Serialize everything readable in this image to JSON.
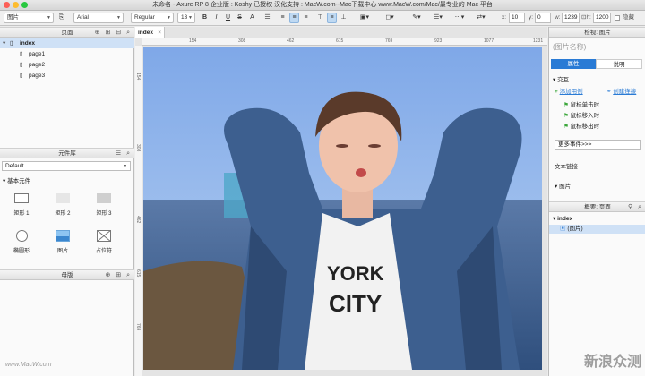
{
  "window": {
    "title": "未命名 - Axure RP 8 企业版 : Koshy 已授权 汉化支持 : MacW.com--Mac下载中心 www.MacW.com/Mac/最专业的 Mac 平台"
  },
  "toolbar": {
    "type_select": "图片",
    "font_select": "Arial",
    "weight_select": "Regular",
    "size_select": "13",
    "bold": "B",
    "italic": "I",
    "underline": "U",
    "strike": "S",
    "x_label": "x:",
    "x_value": "10",
    "y_label": "y:",
    "y_value": "0",
    "w_label": "w:",
    "w_value": "1239",
    "h_value": "1200",
    "hidden_label": "隐藏"
  },
  "pages_panel": {
    "header": "页面",
    "root": "index",
    "items": [
      "page1",
      "page2",
      "page3"
    ]
  },
  "library_panel": {
    "header": "元件库",
    "selected_library": "Default",
    "category": "基本元件",
    "widgets": [
      {
        "label": "矩形 1",
        "icon": "rectangle-icon"
      },
      {
        "label": "矩形 2",
        "icon": "rectangle-icon"
      },
      {
        "label": "矩形 3",
        "icon": "rectangle-icon"
      },
      {
        "label": "椭圆形",
        "icon": "ellipse-icon"
      },
      {
        "label": "图片",
        "icon": "image-icon"
      },
      {
        "label": "占位符",
        "icon": "placeholder-icon"
      }
    ]
  },
  "masters_panel": {
    "header": "母版"
  },
  "canvas": {
    "tab_label": "index",
    "ruler_h": [
      "154",
      "308",
      "462",
      "615",
      "769",
      "923",
      "1077",
      "1231"
    ],
    "ruler_v": [
      "154",
      "308",
      "462",
      "615",
      "769"
    ]
  },
  "inspector": {
    "header": "检视: 图片",
    "name_placeholder": "(图片名称)",
    "tabs": [
      "属性",
      "说明"
    ],
    "interaction_title": "交互",
    "add_case": "添加用例",
    "create_link": "创建连接",
    "events": [
      "鼠标单击时",
      "鼠标移入时",
      "鼠标移出时"
    ],
    "more_events": "更多事件>>>",
    "text_link": "文本链接",
    "image_section": "图片"
  },
  "outline_panel": {
    "header": "概要: 页面",
    "root": "index",
    "item": "(图片)"
  },
  "colors": {
    "accent": "#2a7bd5",
    "selected_row": "#cfe1f6"
  },
  "watermark": {
    "left": "www.MacW.com",
    "right": "新浪众测"
  }
}
